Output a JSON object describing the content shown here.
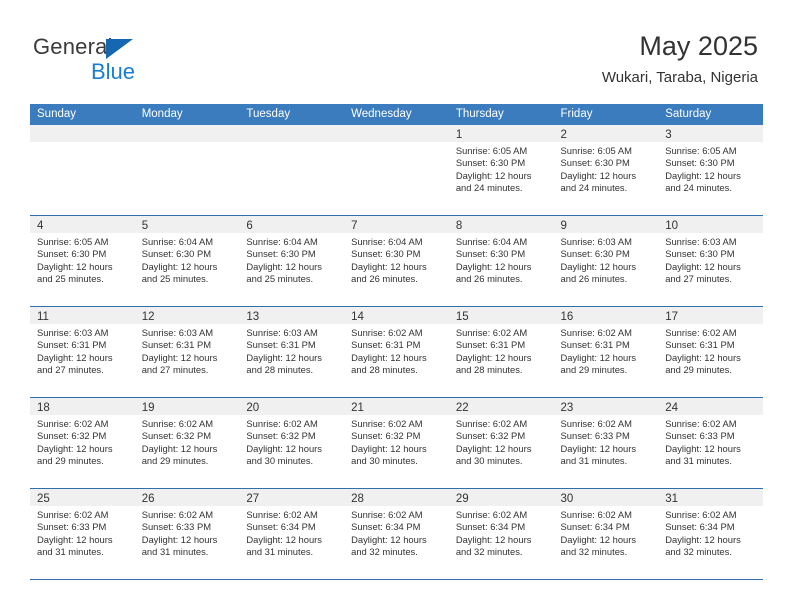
{
  "brand": {
    "name_part1": "General",
    "name_part2": "Blue",
    "logo_icon": "blue-triangle-flag-icon"
  },
  "header": {
    "title": "May 2025",
    "subtitle": "Wukari, Taraba, Nigeria"
  },
  "colors": {
    "header_blue": "#3a7cbe",
    "grid_line": "#2f6fae",
    "daynum_band": "#f0f0f0",
    "logo_blue": "#1a7fd4",
    "text": "#333333"
  },
  "weekdays": [
    "Sunday",
    "Monday",
    "Tuesday",
    "Wednesday",
    "Thursday",
    "Friday",
    "Saturday"
  ],
  "labels": {
    "sunrise_prefix": "Sunrise:",
    "sunset_prefix": "Sunset:",
    "daylight_prefix": "Daylight:"
  },
  "weeks": [
    [
      {
        "day": "",
        "empty": true
      },
      {
        "day": "",
        "empty": true
      },
      {
        "day": "",
        "empty": true
      },
      {
        "day": "",
        "empty": true
      },
      {
        "day": "1",
        "sunrise": "Sunrise: 6:05 AM",
        "sunset": "Sunset: 6:30 PM",
        "daylight_line1": "Daylight: 12 hours",
        "daylight_line2": "and 24 minutes."
      },
      {
        "day": "2",
        "sunrise": "Sunrise: 6:05 AM",
        "sunset": "Sunset: 6:30 PM",
        "daylight_line1": "Daylight: 12 hours",
        "daylight_line2": "and 24 minutes."
      },
      {
        "day": "3",
        "sunrise": "Sunrise: 6:05 AM",
        "sunset": "Sunset: 6:30 PM",
        "daylight_line1": "Daylight: 12 hours",
        "daylight_line2": "and 24 minutes."
      }
    ],
    [
      {
        "day": "4",
        "sunrise": "Sunrise: 6:05 AM",
        "sunset": "Sunset: 6:30 PM",
        "daylight_line1": "Daylight: 12 hours",
        "daylight_line2": "and 25 minutes."
      },
      {
        "day": "5",
        "sunrise": "Sunrise: 6:04 AM",
        "sunset": "Sunset: 6:30 PM",
        "daylight_line1": "Daylight: 12 hours",
        "daylight_line2": "and 25 minutes."
      },
      {
        "day": "6",
        "sunrise": "Sunrise: 6:04 AM",
        "sunset": "Sunset: 6:30 PM",
        "daylight_line1": "Daylight: 12 hours",
        "daylight_line2": "and 25 minutes."
      },
      {
        "day": "7",
        "sunrise": "Sunrise: 6:04 AM",
        "sunset": "Sunset: 6:30 PM",
        "daylight_line1": "Daylight: 12 hours",
        "daylight_line2": "and 26 minutes."
      },
      {
        "day": "8",
        "sunrise": "Sunrise: 6:04 AM",
        "sunset": "Sunset: 6:30 PM",
        "daylight_line1": "Daylight: 12 hours",
        "daylight_line2": "and 26 minutes."
      },
      {
        "day": "9",
        "sunrise": "Sunrise: 6:03 AM",
        "sunset": "Sunset: 6:30 PM",
        "daylight_line1": "Daylight: 12 hours",
        "daylight_line2": "and 26 minutes."
      },
      {
        "day": "10",
        "sunrise": "Sunrise: 6:03 AM",
        "sunset": "Sunset: 6:30 PM",
        "daylight_line1": "Daylight: 12 hours",
        "daylight_line2": "and 27 minutes."
      }
    ],
    [
      {
        "day": "11",
        "sunrise": "Sunrise: 6:03 AM",
        "sunset": "Sunset: 6:31 PM",
        "daylight_line1": "Daylight: 12 hours",
        "daylight_line2": "and 27 minutes."
      },
      {
        "day": "12",
        "sunrise": "Sunrise: 6:03 AM",
        "sunset": "Sunset: 6:31 PM",
        "daylight_line1": "Daylight: 12 hours",
        "daylight_line2": "and 27 minutes."
      },
      {
        "day": "13",
        "sunrise": "Sunrise: 6:03 AM",
        "sunset": "Sunset: 6:31 PM",
        "daylight_line1": "Daylight: 12 hours",
        "daylight_line2": "and 28 minutes."
      },
      {
        "day": "14",
        "sunrise": "Sunrise: 6:02 AM",
        "sunset": "Sunset: 6:31 PM",
        "daylight_line1": "Daylight: 12 hours",
        "daylight_line2": "and 28 minutes."
      },
      {
        "day": "15",
        "sunrise": "Sunrise: 6:02 AM",
        "sunset": "Sunset: 6:31 PM",
        "daylight_line1": "Daylight: 12 hours",
        "daylight_line2": "and 28 minutes."
      },
      {
        "day": "16",
        "sunrise": "Sunrise: 6:02 AM",
        "sunset": "Sunset: 6:31 PM",
        "daylight_line1": "Daylight: 12 hours",
        "daylight_line2": "and 29 minutes."
      },
      {
        "day": "17",
        "sunrise": "Sunrise: 6:02 AM",
        "sunset": "Sunset: 6:31 PM",
        "daylight_line1": "Daylight: 12 hours",
        "daylight_line2": "and 29 minutes."
      }
    ],
    [
      {
        "day": "18",
        "sunrise": "Sunrise: 6:02 AM",
        "sunset": "Sunset: 6:32 PM",
        "daylight_line1": "Daylight: 12 hours",
        "daylight_line2": "and 29 minutes."
      },
      {
        "day": "19",
        "sunrise": "Sunrise: 6:02 AM",
        "sunset": "Sunset: 6:32 PM",
        "daylight_line1": "Daylight: 12 hours",
        "daylight_line2": "and 29 minutes."
      },
      {
        "day": "20",
        "sunrise": "Sunrise: 6:02 AM",
        "sunset": "Sunset: 6:32 PM",
        "daylight_line1": "Daylight: 12 hours",
        "daylight_line2": "and 30 minutes."
      },
      {
        "day": "21",
        "sunrise": "Sunrise: 6:02 AM",
        "sunset": "Sunset: 6:32 PM",
        "daylight_line1": "Daylight: 12 hours",
        "daylight_line2": "and 30 minutes."
      },
      {
        "day": "22",
        "sunrise": "Sunrise: 6:02 AM",
        "sunset": "Sunset: 6:32 PM",
        "daylight_line1": "Daylight: 12 hours",
        "daylight_line2": "and 30 minutes."
      },
      {
        "day": "23",
        "sunrise": "Sunrise: 6:02 AM",
        "sunset": "Sunset: 6:33 PM",
        "daylight_line1": "Daylight: 12 hours",
        "daylight_line2": "and 31 minutes."
      },
      {
        "day": "24",
        "sunrise": "Sunrise: 6:02 AM",
        "sunset": "Sunset: 6:33 PM",
        "daylight_line1": "Daylight: 12 hours",
        "daylight_line2": "and 31 minutes."
      }
    ],
    [
      {
        "day": "25",
        "sunrise": "Sunrise: 6:02 AM",
        "sunset": "Sunset: 6:33 PM",
        "daylight_line1": "Daylight: 12 hours",
        "daylight_line2": "and 31 minutes."
      },
      {
        "day": "26",
        "sunrise": "Sunrise: 6:02 AM",
        "sunset": "Sunset: 6:33 PM",
        "daylight_line1": "Daylight: 12 hours",
        "daylight_line2": "and 31 minutes."
      },
      {
        "day": "27",
        "sunrise": "Sunrise: 6:02 AM",
        "sunset": "Sunset: 6:34 PM",
        "daylight_line1": "Daylight: 12 hours",
        "daylight_line2": "and 31 minutes."
      },
      {
        "day": "28",
        "sunrise": "Sunrise: 6:02 AM",
        "sunset": "Sunset: 6:34 PM",
        "daylight_line1": "Daylight: 12 hours",
        "daylight_line2": "and 32 minutes."
      },
      {
        "day": "29",
        "sunrise": "Sunrise: 6:02 AM",
        "sunset": "Sunset: 6:34 PM",
        "daylight_line1": "Daylight: 12 hours",
        "daylight_line2": "and 32 minutes."
      },
      {
        "day": "30",
        "sunrise": "Sunrise: 6:02 AM",
        "sunset": "Sunset: 6:34 PM",
        "daylight_line1": "Daylight: 12 hours",
        "daylight_line2": "and 32 minutes."
      },
      {
        "day": "31",
        "sunrise": "Sunrise: 6:02 AM",
        "sunset": "Sunset: 6:34 PM",
        "daylight_line1": "Daylight: 12 hours",
        "daylight_line2": "and 32 minutes."
      }
    ]
  ]
}
